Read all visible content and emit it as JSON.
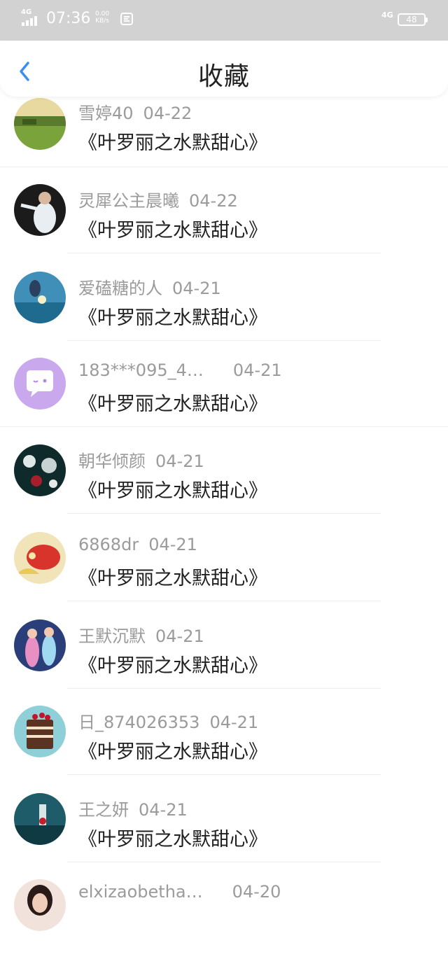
{
  "status_bar": {
    "network_label": "4G",
    "time": "07:36",
    "speed_value": "0.00",
    "speed_unit": "KB/s",
    "network_right": "4G",
    "battery": "48"
  },
  "header": {
    "title": "收藏"
  },
  "items": [
    {
      "user": "雪婷40",
      "date": "04-22",
      "title": "《叶罗丽之水默甜心》"
    },
    {
      "user": "灵犀公主晨曦",
      "date": "04-22",
      "title": "《叶罗丽之水默甜心》"
    },
    {
      "user": "爱磕糖的人",
      "date": "04-21",
      "title": "《叶罗丽之水默甜心》"
    },
    {
      "user": "183***095_4…",
      "date": "04-21",
      "title": "《叶罗丽之水默甜心》"
    },
    {
      "user": "朝华倾颜",
      "date": "04-21",
      "title": "《叶罗丽之水默甜心》"
    },
    {
      "user": "6868dr",
      "date": "04-21",
      "title": "《叶罗丽之水默甜心》"
    },
    {
      "user": "王默沉默",
      "date": "04-21",
      "title": "《叶罗丽之水默甜心》"
    },
    {
      "user": "日_874026353",
      "date": "04-21",
      "title": "《叶罗丽之水默甜心》"
    },
    {
      "user": "王之妍",
      "date": "04-21",
      "title": "《叶罗丽之水默甜心》"
    },
    {
      "user": "elxizaobetha…",
      "date": "04-20",
      "title": ""
    }
  ],
  "colors": {
    "accent": "#3d8ef0",
    "status_bar_bg": "#d2d2d2",
    "meta_text": "#9b9b9b",
    "title_text": "#202020"
  }
}
